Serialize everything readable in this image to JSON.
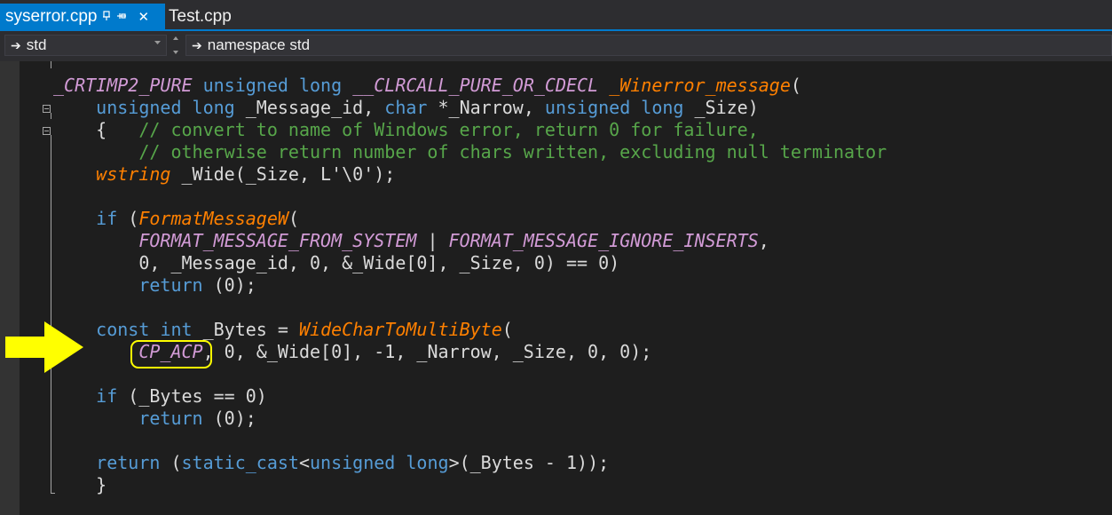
{
  "tabs": {
    "active": {
      "label": "syserror.cpp",
      "pin_glyph": "⊕",
      "close_glyph": "✕"
    },
    "inactive": {
      "label": "Test.cpp"
    }
  },
  "navbar": {
    "scope": "std",
    "member": "namespace std",
    "arrow_glyph": "➔"
  },
  "code": {
    "lines": [
      [
        {
          "t": "_CRTIMP2_PURE",
          "c": "mac"
        },
        {
          "t": " ",
          "c": ""
        },
        {
          "t": "unsigned",
          "c": "kw"
        },
        {
          "t": " ",
          "c": ""
        },
        {
          "t": "long",
          "c": "kw"
        },
        {
          "t": " ",
          "c": ""
        },
        {
          "t": "__CLRCALL_PURE_OR_CDECL",
          "c": "mac"
        },
        {
          "t": " ",
          "c": ""
        },
        {
          "t": "_Winerror_message",
          "c": "fn"
        },
        {
          "t": "(",
          "c": ""
        }
      ],
      [
        {
          "t": "    ",
          "c": ""
        },
        {
          "t": "unsigned",
          "c": "kw"
        },
        {
          "t": " ",
          "c": ""
        },
        {
          "t": "long",
          "c": "kw"
        },
        {
          "t": " _Message_id, ",
          "c": ""
        },
        {
          "t": "char",
          "c": "kw"
        },
        {
          "t": " *_Narrow, ",
          "c": ""
        },
        {
          "t": "unsigned",
          "c": "kw"
        },
        {
          "t": " ",
          "c": ""
        },
        {
          "t": "long",
          "c": "kw"
        },
        {
          "t": " _Size)",
          "c": ""
        }
      ],
      [
        {
          "t": "    {   ",
          "c": ""
        },
        {
          "t": "// convert to name of Windows error, return 0 for failure,",
          "c": "cm"
        }
      ],
      [
        {
          "t": "        ",
          "c": ""
        },
        {
          "t": "// otherwise return number of chars written, excluding null terminator",
          "c": "cm"
        }
      ],
      [
        {
          "t": "    ",
          "c": ""
        },
        {
          "t": "wstring",
          "c": "ty"
        },
        {
          "t": " _Wide(_Size, L'\\0');",
          "c": ""
        }
      ],
      [],
      [
        {
          "t": "    ",
          "c": ""
        },
        {
          "t": "if",
          "c": "kw"
        },
        {
          "t": " (",
          "c": ""
        },
        {
          "t": "FormatMessageW",
          "c": "fn"
        },
        {
          "t": "(",
          "c": ""
        }
      ],
      [
        {
          "t": "        ",
          "c": ""
        },
        {
          "t": "FORMAT_MESSAGE_FROM_SYSTEM",
          "c": "mac"
        },
        {
          "t": " | ",
          "c": ""
        },
        {
          "t": "FORMAT_MESSAGE_IGNORE_INSERTS",
          "c": "mac"
        },
        {
          "t": ",",
          "c": ""
        }
      ],
      [
        {
          "t": "        0, _Message_id, 0, &_Wide[0], _Size, 0) == 0)",
          "c": ""
        }
      ],
      [
        {
          "t": "        ",
          "c": ""
        },
        {
          "t": "return",
          "c": "kw"
        },
        {
          "t": " (0);",
          "c": ""
        }
      ],
      [],
      [
        {
          "t": "    ",
          "c": ""
        },
        {
          "t": "const",
          "c": "kw"
        },
        {
          "t": " ",
          "c": ""
        },
        {
          "t": "int",
          "c": "kw"
        },
        {
          "t": " _Bytes = ",
          "c": ""
        },
        {
          "t": "WideCharToMultiByte",
          "c": "fn"
        },
        {
          "t": "(",
          "c": ""
        }
      ],
      [
        {
          "t": "        ",
          "c": ""
        },
        {
          "t": "CP_ACP",
          "c": "mac"
        },
        {
          "t": ", 0, &_Wide[0], -1, _Narrow, _Size, 0, 0);",
          "c": ""
        }
      ],
      [],
      [
        {
          "t": "    ",
          "c": ""
        },
        {
          "t": "if",
          "c": "kw"
        },
        {
          "t": " (_Bytes == 0)",
          "c": ""
        }
      ],
      [
        {
          "t": "        ",
          "c": ""
        },
        {
          "t": "return",
          "c": "kw"
        },
        {
          "t": " (0);",
          "c": ""
        }
      ],
      [],
      [
        {
          "t": "    ",
          "c": ""
        },
        {
          "t": "return",
          "c": "kw"
        },
        {
          "t": " (",
          "c": ""
        },
        {
          "t": "static_cast",
          "c": "kw"
        },
        {
          "t": "<",
          "c": ""
        },
        {
          "t": "unsigned",
          "c": "kw"
        },
        {
          "t": " ",
          "c": ""
        },
        {
          "t": "long",
          "c": "kw"
        },
        {
          "t": ">(_Bytes - 1));",
          "c": ""
        }
      ],
      [
        {
          "t": "    }",
          "c": ""
        }
      ]
    ]
  },
  "annotation": {
    "arrow_color": "#ffff00",
    "ring_color": "#ffff00",
    "highlighted_token": "CP_ACP"
  }
}
